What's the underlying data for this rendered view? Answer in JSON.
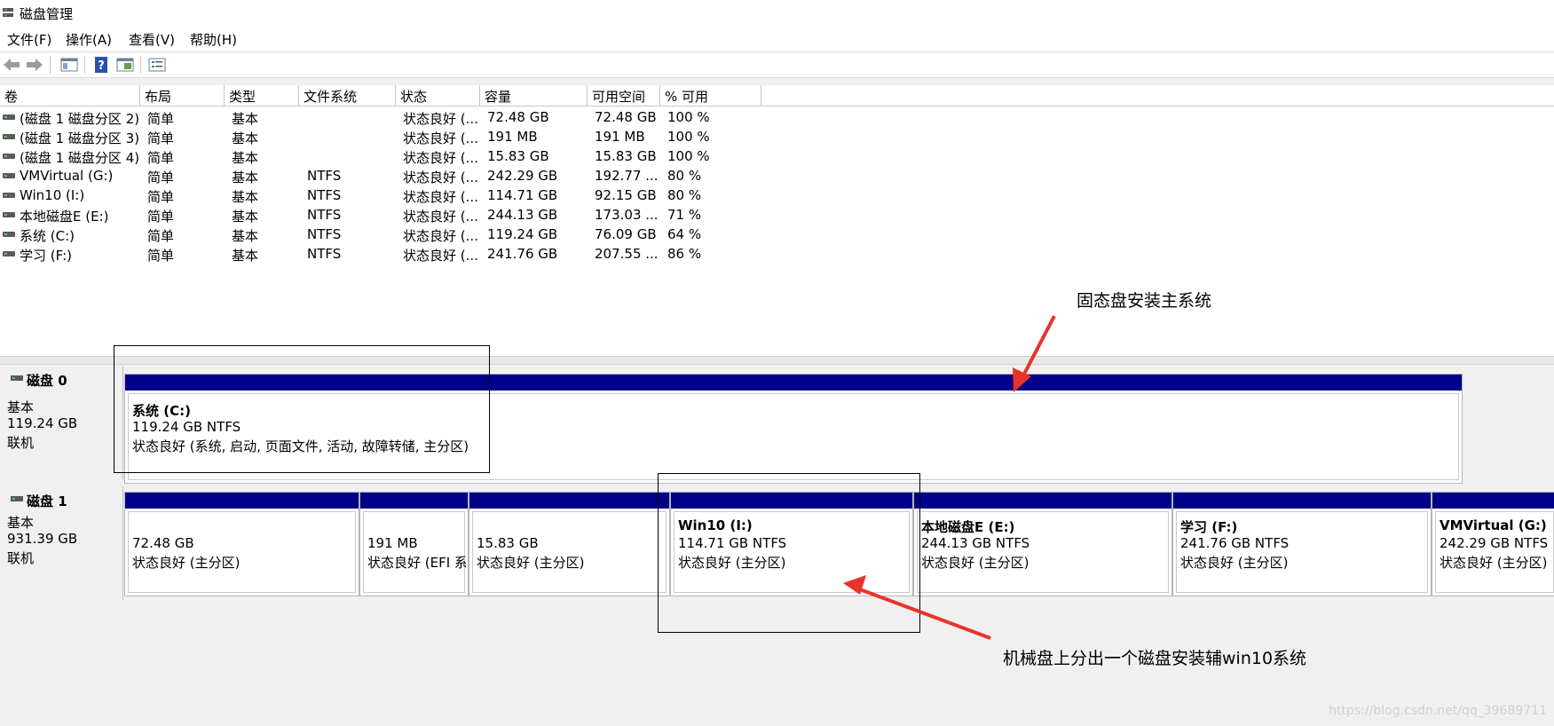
{
  "app": {
    "title": "磁盘管理"
  },
  "menu": [
    "文件(F)",
    "操作(A)",
    "查看(V)",
    "帮助(H)"
  ],
  "toolbar": [
    "back-arrow-icon",
    "forward-arrow-icon",
    "console-tree-icon",
    "help-icon",
    "properties-icon",
    "list-view-icon"
  ],
  "columns": [
    "卷",
    "布局",
    "类型",
    "文件系统",
    "状态",
    "容量",
    "可用空间",
    "% 可用"
  ],
  "volumes": [
    [
      "(磁盘 1 磁盘分区 2)",
      "简单",
      "基本",
      "",
      "状态良好 (...",
      "72.48 GB",
      "72.48 GB",
      "100 %"
    ],
    [
      "(磁盘 1 磁盘分区 3)",
      "简单",
      "基本",
      "",
      "状态良好 (...",
      "191 MB",
      "191 MB",
      "100 %"
    ],
    [
      "(磁盘 1 磁盘分区 4)",
      "简单",
      "基本",
      "",
      "状态良好 (...",
      "15.83 GB",
      "15.83 GB",
      "100 %"
    ],
    [
      "VMVirtual (G:)",
      "简单",
      "基本",
      "NTFS",
      "状态良好 (...",
      "242.29 GB",
      "192.77 ...",
      "80 %"
    ],
    [
      "Win10 (I:)",
      "简单",
      "基本",
      "NTFS",
      "状态良好 (...",
      "114.71 GB",
      "92.15 GB",
      "80 %"
    ],
    [
      "本地磁盘E (E:)",
      "简单",
      "基本",
      "NTFS",
      "状态良好 (...",
      "244.13 GB",
      "173.03 ...",
      "71 %"
    ],
    [
      "系统 (C:)",
      "简单",
      "基本",
      "NTFS",
      "状态良好 (...",
      "119.24 GB",
      "76.09 GB",
      "64 %"
    ],
    [
      "学习 (F:)",
      "简单",
      "基本",
      "NTFS",
      "状态良好 (...",
      "241.76 GB",
      "207.55 ...",
      "86 %"
    ]
  ],
  "disk0": {
    "name": "磁盘 0",
    "type": "基本",
    "size": "119.24 GB",
    "status": "联机",
    "partitions": [
      {
        "title": "系统  (C:)",
        "size": "119.24 GB NTFS",
        "status": "状态良好 (系统, 启动, 页面文件, 活动, 故障转储, 主分区)"
      }
    ]
  },
  "disk1": {
    "name": "磁盘 1",
    "type": "基本",
    "size": "931.39 GB",
    "status": "联机",
    "partitions": [
      {
        "title": "",
        "size": "72.48 GB",
        "status": "状态良好 (主分区)"
      },
      {
        "title": "",
        "size": "191 MB",
        "status": "状态良好 (EFI 系"
      },
      {
        "title": "",
        "size": "15.83 GB",
        "status": "状态良好 (主分区)"
      },
      {
        "title": "Win10  (I:)",
        "size": "114.71 GB NTFS",
        "status": "状态良好 (主分区)"
      },
      {
        "title": "本地磁盘E  (E:)",
        "size": "244.13 GB NTFS",
        "status": "状态良好 (主分区)"
      },
      {
        "title": "学习  (F:)",
        "size": "241.76 GB NTFS",
        "status": "状态良好 (主分区)"
      },
      {
        "title": "VMVirtual  (G:)",
        "size": "242.29 GB NTFS",
        "status": "状态良好 (主分区)"
      }
    ]
  },
  "annotations": {
    "ssd_note": "固态盘安装主系统",
    "hdd_note": "机械盘上分出一个磁盘安装辅win10系统",
    "color": "#e8332b"
  },
  "watermark": "https://blog.csdn.net/qq_39689711"
}
